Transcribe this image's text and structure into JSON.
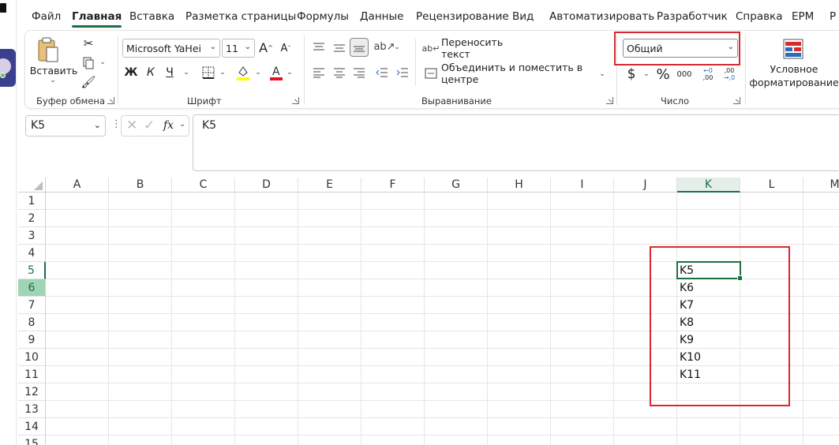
{
  "tabs": [
    "Файл",
    "Главная",
    "Вставка",
    "Разметка страницы",
    "Формулы",
    "Данные",
    "Рецензирование",
    "Вид",
    "Автоматизировать",
    "Разработчик",
    "Справка",
    "EPM",
    "Р"
  ],
  "ribbon": {
    "clipboard": {
      "paste_label": "Вставить",
      "group_label": "Буфер обмена"
    },
    "font": {
      "name": "Microsoft YaHei",
      "size": "11",
      "bold": "Ж",
      "italic": "К",
      "underline": "Ч",
      "grow": "A",
      "shrink": "A",
      "group_label": "Шрифт",
      "highlight_color": "#ffff00",
      "font_color": "#e81123"
    },
    "alignment": {
      "wrap_text": "Переносить текст",
      "merge_center": "Объединить и поместить в центре",
      "group_label": "Выравнивание"
    },
    "number": {
      "format": "Общий",
      "currency": "$",
      "percent": "%",
      "comma": "000",
      "group_label": "Число"
    },
    "styles": {
      "conditional_line1": "Условное",
      "conditional_line2": "форматирование"
    }
  },
  "formula_bar": {
    "name_box": "K5",
    "fx": "fx",
    "content": "K5"
  },
  "grid": {
    "columns": [
      "A",
      "B",
      "C",
      "D",
      "E",
      "F",
      "G",
      "H",
      "I",
      "J",
      "K",
      "L",
      "M"
    ],
    "selected_column": "K",
    "rows": [
      "1",
      "2",
      "3",
      "4",
      "5",
      "6",
      "7",
      "8",
      "9",
      "10",
      "11",
      "12",
      "13",
      "14",
      "15"
    ],
    "active_row": "5",
    "selected_row": "6",
    "k_cells": [
      "K5",
      "K6",
      "K7",
      "K8",
      "K9",
      "K10",
      "K11"
    ]
  },
  "colors": {
    "accent": "#1d6f42",
    "highlight_box": "#d9282f"
  }
}
